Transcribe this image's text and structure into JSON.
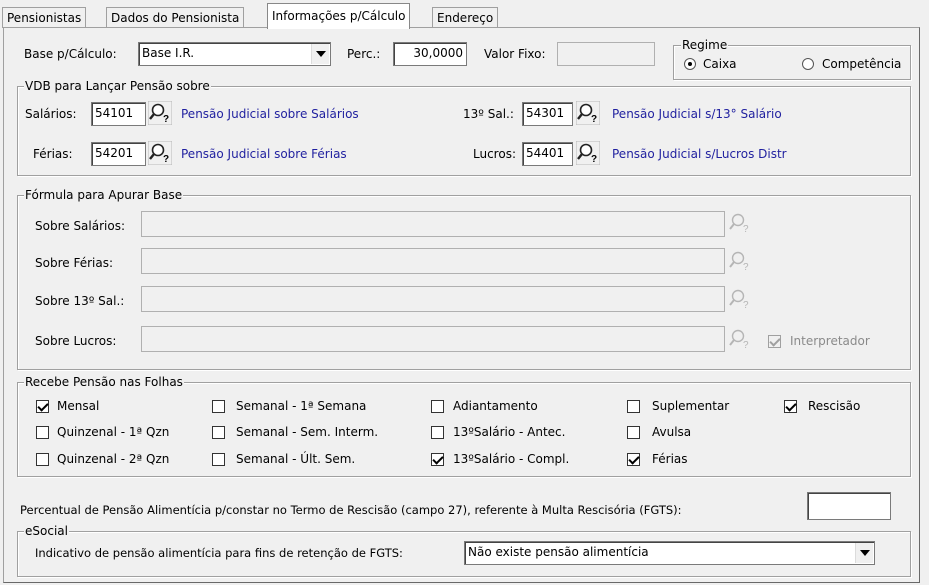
{
  "tabs": [
    "Pensionistas",
    "Dados do Pensionista",
    "Informações p/Cálculo",
    "Endereço"
  ],
  "top": {
    "base_label": "Base p/Cálculo:",
    "base_value": "Base I.R.",
    "perc_label": "Perc.:",
    "perc_value": "30,0000",
    "valor_fixo_label": "Valor Fixo:",
    "valor_fixo_value": "",
    "regime": {
      "title": "Regime",
      "options": [
        "Caixa",
        "Competência"
      ],
      "selected": "Caixa"
    }
  },
  "vdb": {
    "title": "VDB para Lançar Pensão sobre",
    "salarios": {
      "label": "Salários:",
      "code": "54101",
      "desc": "Pensão Judicial sobre Salários"
    },
    "ferias": {
      "label": "Férias:",
      "code": "54201",
      "desc": "Pensão Judicial sobre Férias"
    },
    "decimo": {
      "label": "13º Sal.:",
      "code": "54301",
      "desc": "Pensão Judicial s/13° Salário"
    },
    "lucros": {
      "label": "Lucros:",
      "code": "54401",
      "desc": "Pensão Judicial s/Lucros Distr"
    }
  },
  "formula": {
    "title": "Fórmula para Apurar Base",
    "rows": [
      {
        "label": "Sobre Salários:",
        "value": ""
      },
      {
        "label": "Sobre Férias:",
        "value": ""
      },
      {
        "label": "Sobre 13º Sal.:",
        "value": ""
      },
      {
        "label": "Sobre Lucros:",
        "value": ""
      }
    ],
    "interpretador_label": "Interpretador",
    "interpretador_checked": true
  },
  "folhas": {
    "title": "Recebe Pensão nas Folhas",
    "items": [
      {
        "label": "Mensal",
        "checked": true
      },
      {
        "label": "Semanal - 1ª Semana",
        "checked": false
      },
      {
        "label": "Adiantamento",
        "checked": false
      },
      {
        "label": "Suplementar",
        "checked": false
      },
      {
        "label": "Rescisão",
        "checked": true
      },
      {
        "label": "Quinzenal - 1ª Qzn",
        "checked": false
      },
      {
        "label": "Semanal - Sem. Interm.",
        "checked": false
      },
      {
        "label": "13ºSalário - Antec.",
        "checked": false
      },
      {
        "label": "Avulsa",
        "checked": false
      },
      {
        "label": "Quinzenal - 2ª Qzn",
        "checked": false
      },
      {
        "label": "Semanal - Últ. Sem.",
        "checked": false
      },
      {
        "label": "13ºSalário - Compl.",
        "checked": true
      },
      {
        "label": "Férias",
        "checked": true
      }
    ]
  },
  "percentual": {
    "label": "Percentual de Pensão Alimentícia p/constar no Termo de Rescisão (campo 27), referente à Multa Rescisória (FGTS):",
    "value": ""
  },
  "esocial": {
    "title": "eSocial",
    "label": "Indicativo de pensão alimentícia para fins de retenção de FGTS:",
    "value": "Não existe pensão alimentícia"
  }
}
